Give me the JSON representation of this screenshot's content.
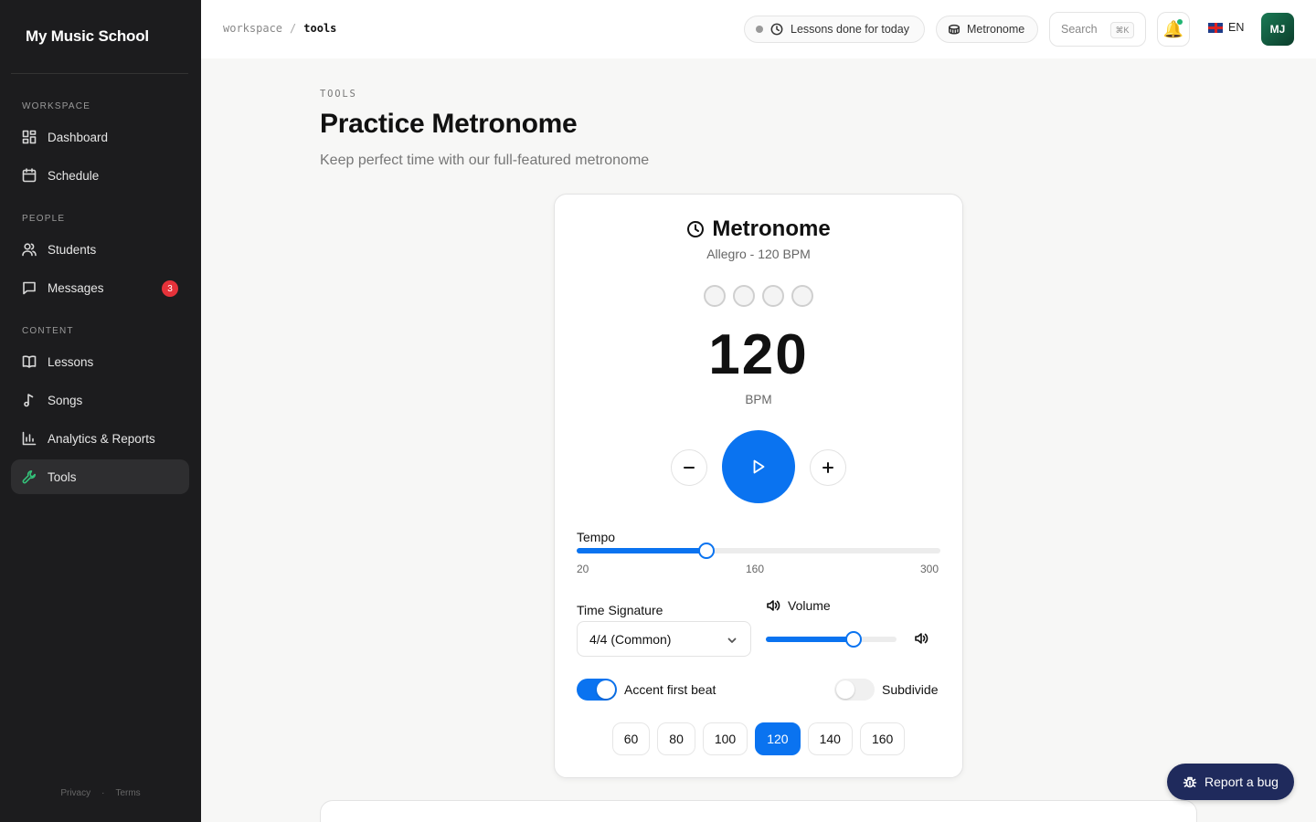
{
  "app": {
    "name": "My Music School"
  },
  "sidebar": {
    "sections": [
      {
        "label": "WORKSPACE"
      },
      {
        "label": "PEOPLE"
      },
      {
        "label": "CONTENT"
      }
    ],
    "items": [
      {
        "label": "Dashboard",
        "icon": "dashboard-icon"
      },
      {
        "label": "Schedule",
        "icon": "calendar-icon"
      },
      {
        "label": "Students",
        "icon": "users-icon"
      },
      {
        "label": "Messages",
        "icon": "message-icon",
        "badge": "3"
      },
      {
        "label": "Lessons",
        "icon": "book-icon"
      },
      {
        "label": "Songs",
        "icon": "music-note-icon"
      },
      {
        "label": "Analytics & Reports",
        "icon": "bar-chart-icon"
      },
      {
        "label": "Tools",
        "icon": "wrench-icon",
        "active": true
      }
    ],
    "footer": {
      "privacy": "Privacy",
      "separator": "·",
      "terms": "Terms"
    }
  },
  "topbar": {
    "breadcrumb": {
      "root": "workspace",
      "separator": "/",
      "current": "tools"
    },
    "status_pill": "Lessons done for today",
    "metronome_pill": "Metronome",
    "search": {
      "placeholder": "Search",
      "shortcut": "⌘K"
    },
    "language": "EN",
    "user_initials": "MJ"
  },
  "page": {
    "eyebrow": "TOOLS",
    "title": "Practice Metronome",
    "subtitle": "Keep perfect time with our full-featured metronome"
  },
  "metronome": {
    "title": "Metronome",
    "subtitle": "Allegro - 120 BPM",
    "bpm": "120",
    "bpm_unit": "BPM",
    "beat_count": 4,
    "tempo": {
      "label": "Tempo",
      "min": 20,
      "max": 300,
      "value": 120,
      "tick_labels": [
        "20",
        "160",
        "300"
      ]
    },
    "time_signature": {
      "label": "Time Signature",
      "value": "4/4 (Common)"
    },
    "volume": {
      "label": "Volume",
      "value_fraction": 0.67
    },
    "accent_first_beat": {
      "label": "Accent first beat",
      "on": true
    },
    "subdivide": {
      "label": "Subdivide",
      "on": false
    },
    "presets": [
      "60",
      "80",
      "100",
      "120",
      "140",
      "160"
    ],
    "selected_preset": "120",
    "accent_color": "#0a73f0"
  },
  "report_bug": "Report a bug",
  "colors": {
    "sidebar_bg": "#1c1c1e",
    "active_icon": "#34c27a",
    "badge": "#e5323a",
    "primary": "#0a73f0",
    "report_button": "#1f2a5c"
  }
}
